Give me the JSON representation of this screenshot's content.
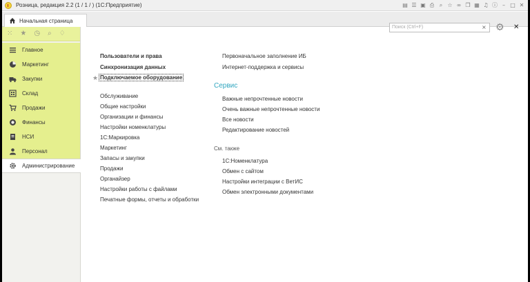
{
  "window": {
    "title": "Розница, редакция 2.2 (1 / 1 / ) (1С:Предприятие)"
  },
  "titlebar_icons": [
    "panel-icon",
    "menu-icon",
    "save-icon",
    "print-icon",
    "find-icon",
    "favorite-icon",
    "link-icon",
    "copy-icon",
    "calc-icon",
    "bell-icon",
    "info-icon",
    "minimize-icon",
    "restore-icon",
    "close-icon"
  ],
  "tabs": {
    "home_label": "Начальная страница"
  },
  "sidebar": {
    "items": [
      {
        "label": "Главное",
        "icon": "list-icon",
        "color": "#4a4a4a"
      },
      {
        "label": "Маркетинг",
        "icon": "pie-icon",
        "color": "#4a4a4a"
      },
      {
        "label": "Закупки",
        "icon": "truck-icon",
        "color": "#4a4a4a"
      },
      {
        "label": "Склад",
        "icon": "warehouse-icon",
        "color": "#4a4a4a"
      },
      {
        "label": "Продажи",
        "icon": "cart-icon",
        "color": "#4a4a4a"
      },
      {
        "label": "Финансы",
        "icon": "coins-icon",
        "color": "#4a4a4a"
      },
      {
        "label": "НСИ",
        "icon": "reference-icon",
        "color": "#4a4a4a"
      },
      {
        "label": "Персонал",
        "icon": "person-icon",
        "color": "#4a4a4a"
      },
      {
        "label": "Администрирование",
        "icon": "gear-icon",
        "color": "#4a4a4a"
      }
    ]
  },
  "search": {
    "placeholder": "Поиск (Ctrl+F)"
  },
  "content": {
    "col1_bold": [
      "Пользователи и права",
      "Синхронизация данных",
      "Подключаемое оборудование"
    ],
    "col1_links": [
      "Обслуживание",
      "Общие настройки",
      "Организации и финансы",
      "Настройки номенклатуры",
      "1С:Маркировка",
      "Маркетинг",
      "Запасы и закупки",
      "Продажи",
      "Органайзер",
      "Настройки работы с файлами",
      "Печатные формы, отчеты и обработки"
    ],
    "col2_top": [
      "Первоначальное заполнение ИБ",
      "Интернет-поддержка и сервисы"
    ],
    "service_title": "Сервис",
    "service_links": [
      "Важные непрочтенные новости",
      "Очень важные непрочтенные новости",
      "Все новости",
      "Редактирование новостей"
    ],
    "see_also_title": "См. также",
    "see_also_links": [
      "1С:Номенклатура",
      "Обмен с сайтом",
      "Настройки интеграции с ВетИС",
      "Обмен электронными документами"
    ]
  },
  "colors": {
    "accent": "#31a6bf",
    "sidebar_highlight": "#e5ef8e"
  }
}
